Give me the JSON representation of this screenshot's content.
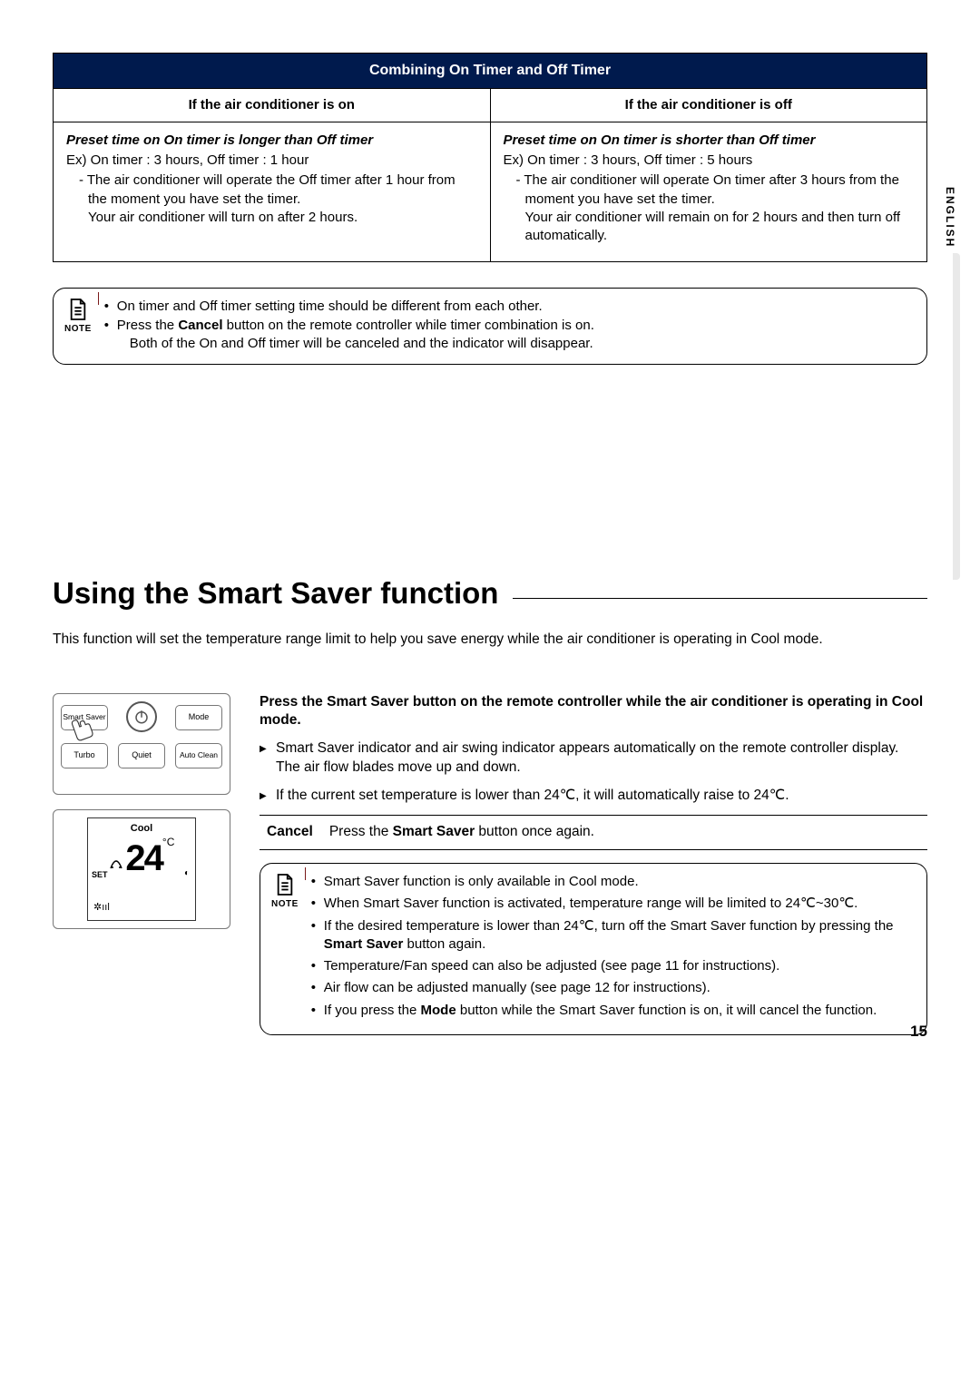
{
  "lang_tab": "ENGLISH",
  "timer_table": {
    "header": "Combining On Timer and Off Timer",
    "col_on": "If the air conditioner is on",
    "col_off": "If the air conditioner is off",
    "on": {
      "preset": "Preset time on On timer is longer than Off timer",
      "example": "Ex) On timer : 3 hours, Off timer : 1 hour",
      "desc1": "- The air conditioner will operate the Off timer after 1 hour from the moment you have set the timer.",
      "desc2": "Your air conditioner will turn on after 2 hours."
    },
    "off": {
      "preset": "Preset time on On timer is shorter than Off timer",
      "example": "Ex) On timer : 3 hours, Off timer : 5 hours",
      "desc1": "- The air conditioner will operate On timer after 3 hours from the moment you have set the timer.",
      "desc2": "Your air conditioner will remain on for 2 hours and then turn off automatically."
    }
  },
  "timer_note": {
    "label": "NOTE",
    "items": {
      "a": "On timer and Off timer setting time should be different from each other.",
      "b_pre": "Press the ",
      "b_bold": "Cancel",
      "b_post": " button on the remote controller while timer combination is on.",
      "b_cont": "Both of the On and Off timer will be canceled and the indicator will disappear."
    }
  },
  "section_title": "Using the Smart Saver function",
  "intro": "This function will set the temperature range limit to help you save energy while the air conditioner is operating in Cool mode.",
  "remote": {
    "smart_saver": "Smart Saver",
    "mode": "Mode",
    "turbo": "Turbo",
    "quiet": "Quiet",
    "auto_clean": "Auto Clean"
  },
  "display": {
    "mode": "Cool",
    "set": "SET",
    "temp": "24",
    "unit": "°C"
  },
  "ss_lead_pre": "Press the ",
  "ss_lead_bold": "Smart Saver",
  "ss_lead_post": " button on the remote controller while the air conditioner is operating in Cool mode.",
  "ss_points": {
    "a": "Smart Saver indicator and air swing indicator appears automatically on the remote controller display.",
    "a_sub": "The air flow blades move up and down.",
    "b": "If the current set temperature is lower than 24℃, it will automatically raise to 24℃."
  },
  "cancel": {
    "label": "Cancel",
    "text_pre": "Press the ",
    "text_bold": "Smart Saver",
    "text_post": " button once again."
  },
  "ss_note": {
    "label": "NOTE",
    "items": {
      "a": "Smart Saver function is only available in Cool mode.",
      "b": "When Smart Saver function is activated, temperature range will be limited to 24℃~30℃.",
      "c_pre": "If the desired temperature is lower than 24℃, turn off the Smart Saver function by pressing the ",
      "c_bold": "Smart Saver",
      "c_post": " button again.",
      "d": "Temperature/Fan speed can also be adjusted (see page 11 for instructions).",
      "e": "Air flow can be adjusted manually (see page 12 for instructions).",
      "f_pre": "If you press the ",
      "f_bold": "Mode",
      "f_post": " button while the Smart Saver function is on, it will cancel the function."
    }
  },
  "page_number": "15"
}
